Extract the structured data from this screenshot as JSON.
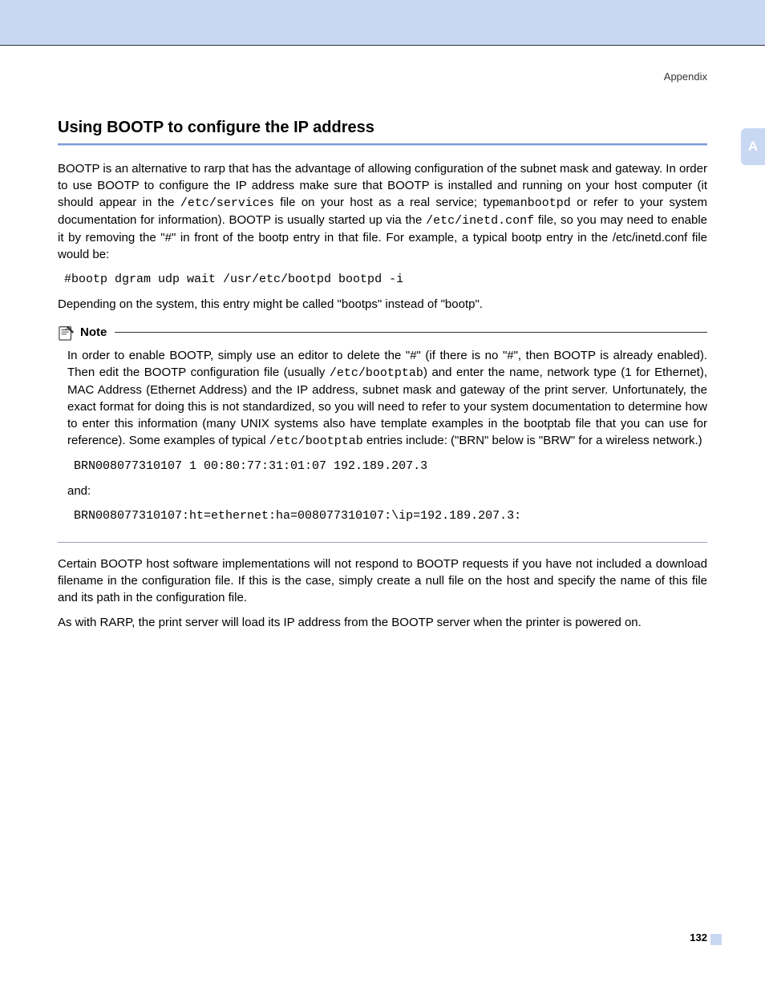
{
  "breadcrumb": "Appendix",
  "side_tab": "A",
  "title": "Using BOOTP to configure the IP address",
  "para1_a": "BOOTP is an alternative to rarp that has the advantage of allowing configuration of the subnet mask and gateway. In order to use BOOTP to configure the IP address make sure that BOOTP is installed and running on your host computer (it should appear in the ",
  "para1_code1": "/etc/services",
  "para1_b": " file on your host as a real service; type",
  "para1_code2": "manbootpd",
  "para1_c": " or refer to your system documentation for information). BOOTP is usually started up via the ",
  "para1_code3": "/etc/inetd.conf",
  "para1_d": " file, so you may need to enable it by removing the \"#\" in front of the bootp entry in that file. For example, a typical bootp entry in the /etc/inetd.conf file would be:",
  "code1": "#bootp dgram udp wait /usr/etc/bootpd bootpd -i",
  "para2": "Depending on the system, this entry might be called \"bootps\" instead of \"bootp\".",
  "note_label": "Note",
  "note_p1_a": "In order to enable BOOTP, simply use an editor to delete the \"#\" (if there is no \"#\", then BOOTP is already enabled). Then edit the BOOTP configuration file (usually ",
  "note_p1_code1": "/etc/bootptab",
  "note_p1_b": ") and enter the name, network type (1 for Ethernet), MAC Address (Ethernet Address) and the IP address, subnet mask and gateway of the print server. Unfortunately, the exact format for doing this is not standardized, so you will need to refer to your system documentation to determine how to enter this information (many UNIX systems also have template examples in the bootptab file that you can use for reference). Some examples of typical ",
  "note_p1_code2": "/etc/bootptab",
  "note_p1_c": " entries include: (\"BRN\" below is \"BRW\" for a wireless network.)",
  "note_code1": "BRN008077310107 1 00:80:77:31:01:07 192.189.207.3",
  "note_and": "and:",
  "note_code2": "BRN008077310107:ht=ethernet:ha=008077310107:\\ip=192.189.207.3:",
  "para3": "Certain BOOTP host software implementations will not respond to BOOTP requests if you have not included a download filename in the configuration file. If this is the case, simply create a null file on the host and specify the name of this file and its path in the configuration file.",
  "para4": "As with RARP, the print server will load its IP address from the BOOTP server when the printer is powered on.",
  "page_number": "132"
}
